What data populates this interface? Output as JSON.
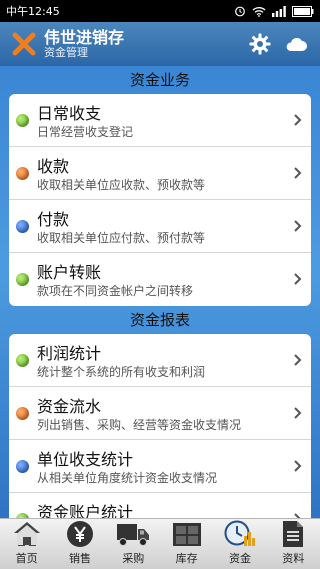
{
  "status_bar": {
    "time": "中午12:45"
  },
  "header": {
    "title": "伟世进销存",
    "subtitle": "资金管理"
  },
  "sections": [
    {
      "title": "资金业务",
      "items": [
        {
          "title": "日常收支",
          "desc": "日常经营收支登记",
          "dot": "green"
        },
        {
          "title": "收款",
          "desc": "收取相关单位应收款、预收款等",
          "dot": "orange"
        },
        {
          "title": "付款",
          "desc": "收取相关单位应付款、预付款等",
          "dot": "blue"
        },
        {
          "title": "账户转账",
          "desc": "款项在不同资金帐户之间转移",
          "dot": "green"
        }
      ]
    },
    {
      "title": "资金报表",
      "items": [
        {
          "title": "利润统计",
          "desc": "统计整个系统的所有收支和利润",
          "dot": "green"
        },
        {
          "title": "资金流水",
          "desc": "列出销售、采购、经营等资金收支情况",
          "dot": "orange"
        },
        {
          "title": "单位收支统计",
          "desc": "从相关单位角度统计资金收支情况",
          "dot": "blue"
        },
        {
          "title": "资金账户统计",
          "desc": "",
          "dot": "green"
        }
      ]
    }
  ],
  "tabs": [
    {
      "label": "首页",
      "icon": "home-icon"
    },
    {
      "label": "销售",
      "icon": "yen-icon"
    },
    {
      "label": "采购",
      "icon": "truck-icon"
    },
    {
      "label": "库存",
      "icon": "warehouse-icon"
    },
    {
      "label": "资金",
      "icon": "clock-chart-icon"
    },
    {
      "label": "资料",
      "icon": "document-icon"
    }
  ],
  "colors": {
    "header": "#2b67a7",
    "content_bg": "#3b86d4"
  }
}
